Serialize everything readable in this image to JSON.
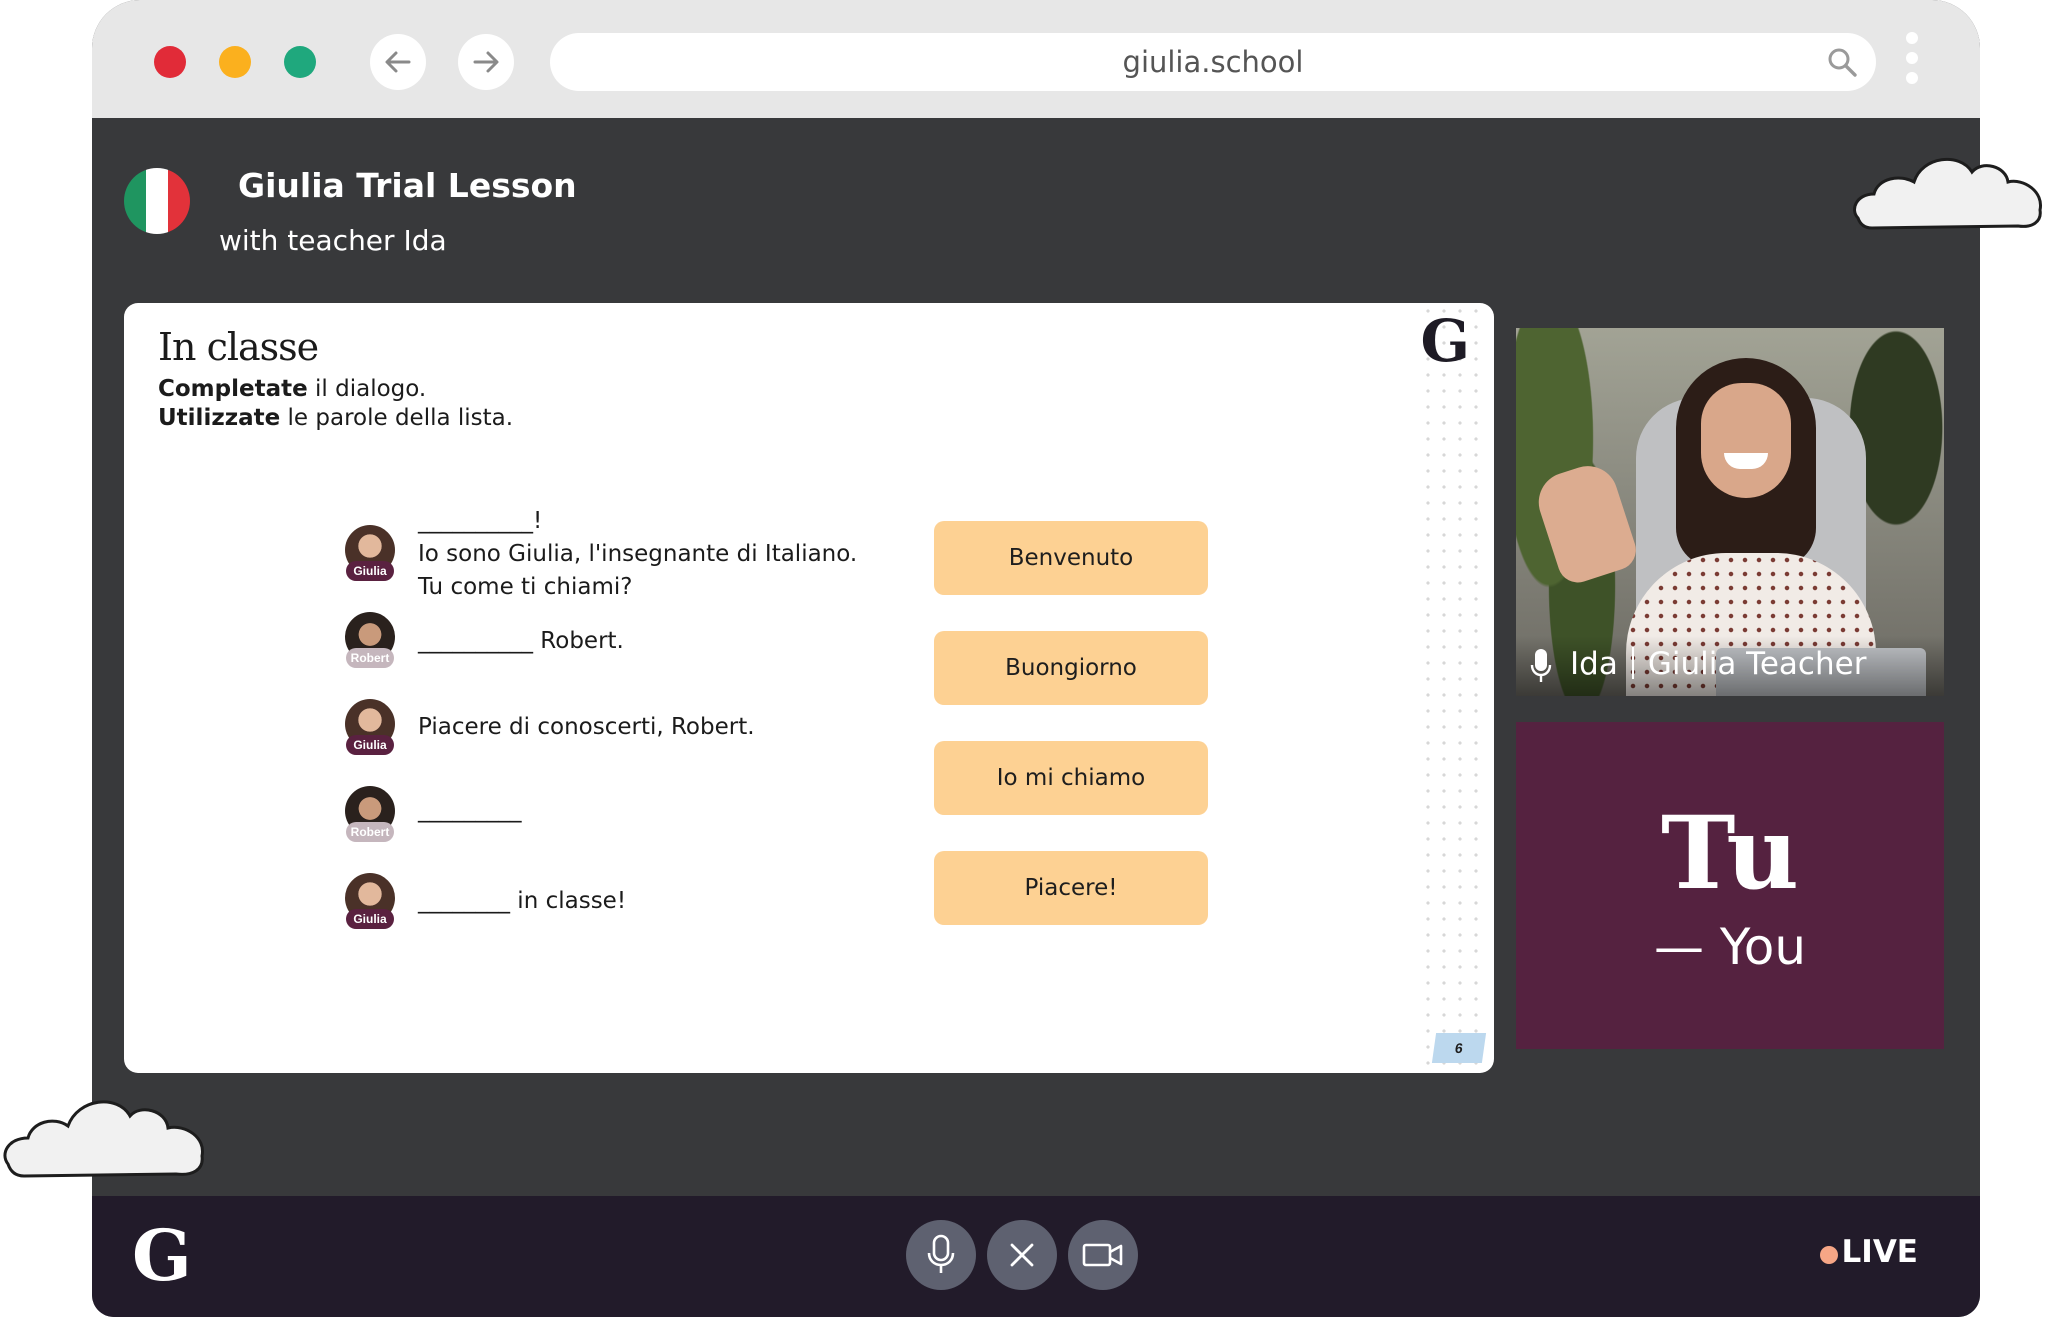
{
  "browser": {
    "url": "giulia.school",
    "icons": {
      "back": "arrow-left-icon",
      "forward": "arrow-right-icon",
      "search": "search-icon",
      "menu": "kebab-menu-icon"
    }
  },
  "lesson": {
    "title": "Giulia Trial Lesson",
    "subtitle": "with teacher Ida",
    "flag_colors": [
      "#1f9560",
      "#ffffff",
      "#e2323a"
    ]
  },
  "slide": {
    "heading": "In classe",
    "instruction1_bold": "Completate",
    "instruction1_rest": " il dialogo.",
    "instruction2_bold": "Utilizzate",
    "instruction2_rest": " le parole della lista.",
    "dialogue": [
      {
        "speaker": "Giulia",
        "lines": [
          "__________!",
          "Io sono Giulia, l'insegnante di Italiano.",
          "Tu come ti chiami?"
        ]
      },
      {
        "speaker": "Robert",
        "lines": [
          "__________ Robert."
        ]
      },
      {
        "speaker": "Giulia",
        "lines": [
          "Piacere di conoscerti, Robert."
        ]
      },
      {
        "speaker": "Robert",
        "lines": [
          "_________"
        ]
      },
      {
        "speaker": "Giulia",
        "lines": [
          "________ in classe!"
        ]
      }
    ],
    "word_list": [
      "Benvenuto",
      "Buongiorno",
      "Io mi chiamo",
      "Piacere!"
    ],
    "logo": "G",
    "page_number": "6"
  },
  "teacher_video": {
    "name": "Ida",
    "role": "Giulia Teacher"
  },
  "self_view": {
    "title": "Tu",
    "subtitle": "— You"
  },
  "bottom_bar": {
    "logo": "G",
    "live_label": "LIVE",
    "controls": [
      "microphone-icon",
      "hang-up-icon",
      "camera-icon"
    ]
  },
  "colors": {
    "window_bg": "#38393b",
    "word_button": "#fdd193",
    "self_view_bg": "#552240",
    "bottom_bar": "#221b2a",
    "live_dot": "#f6a686"
  }
}
